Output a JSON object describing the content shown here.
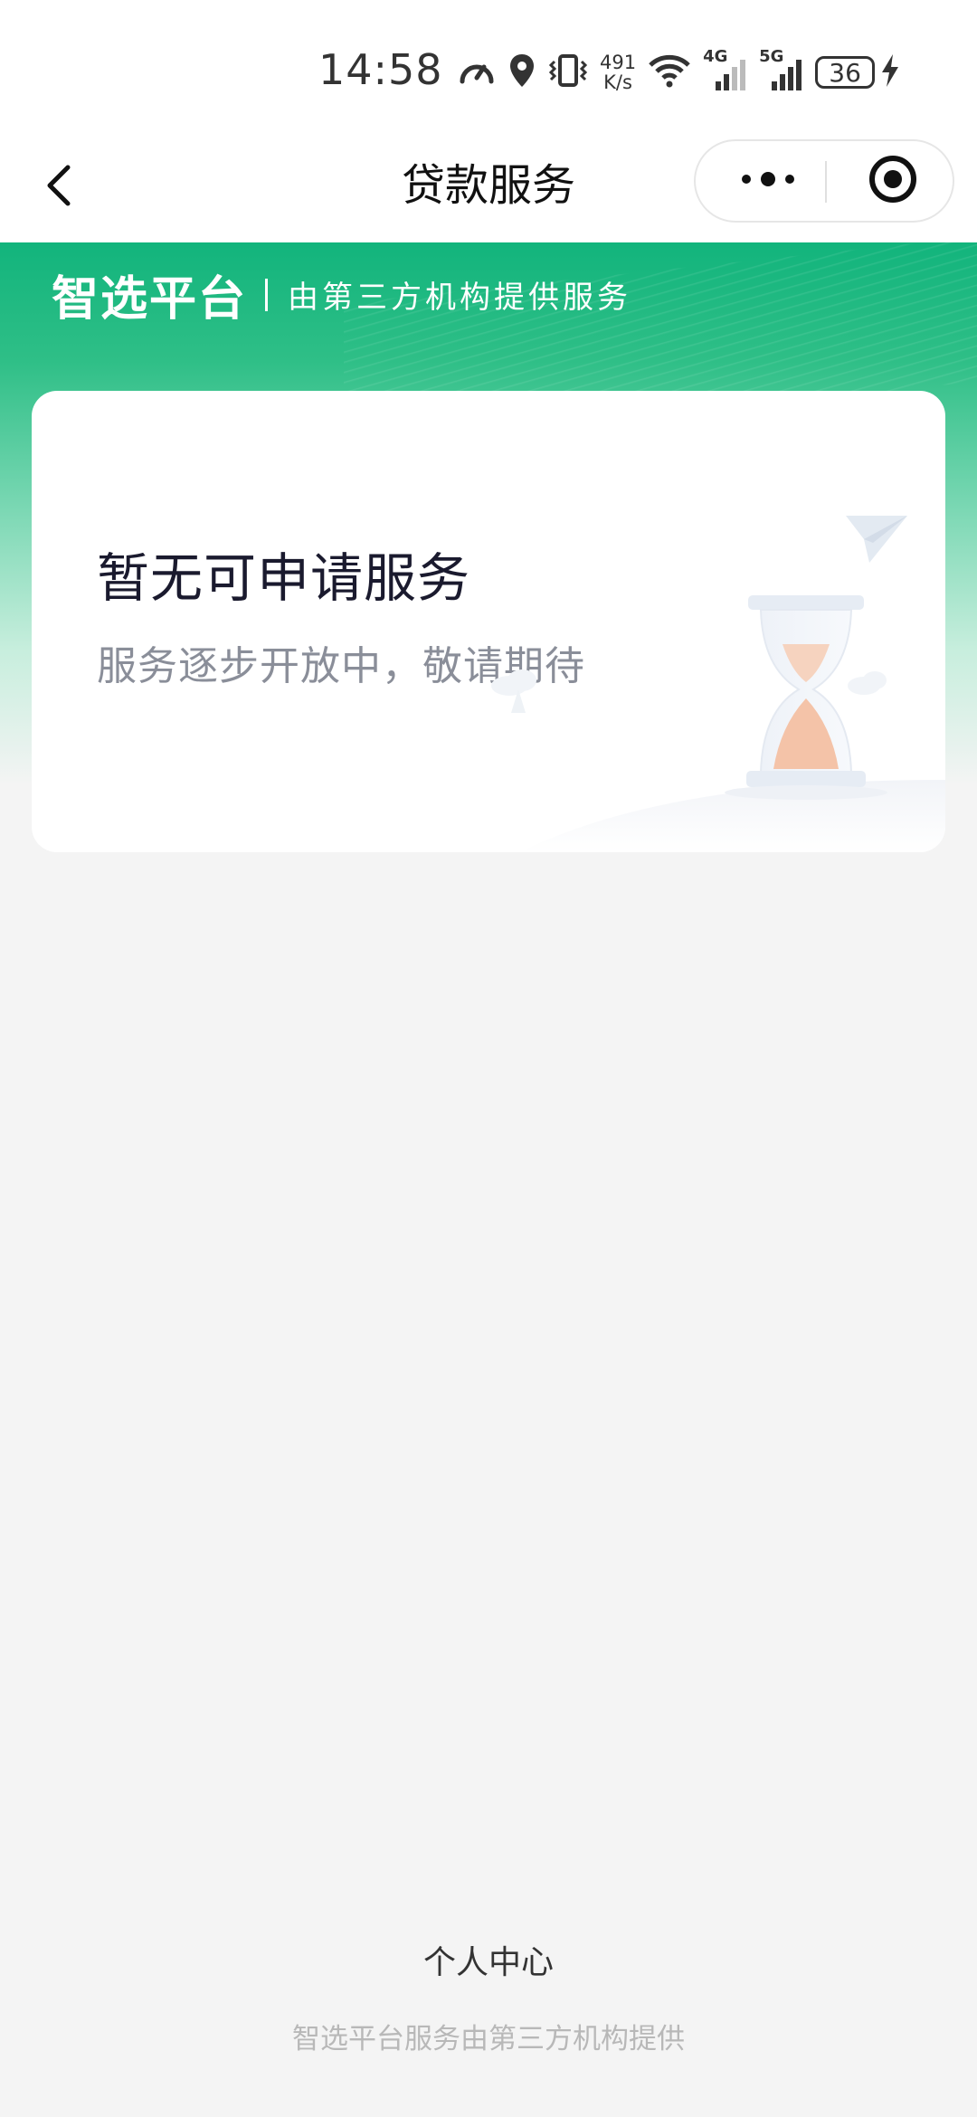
{
  "status_bar": {
    "time": "14:58",
    "net_speed_value": "491",
    "net_speed_unit": "K/s",
    "sim1_gen": "4G",
    "sim2_gen": "5G",
    "battery": "36",
    "icons": [
      "speedometer-icon",
      "location-icon",
      "vibrate-icon",
      "wifi-icon",
      "signal-icon",
      "signal-icon",
      "battery-icon",
      "charging-icon"
    ]
  },
  "nav": {
    "title": "贷款服务",
    "back_icon": "chevron-left-icon",
    "more_icon": "more-dots-icon",
    "close_icon": "target-close-icon"
  },
  "header": {
    "brand": "智选平台",
    "subtitle": "由第三方机构提供服务",
    "colors": {
      "primary": "#12b47c"
    }
  },
  "card": {
    "title": "暂无可申请服务",
    "subtitle": "服务逐步开放中，敬请期待",
    "illustration": "hourglass-illustration"
  },
  "footer": {
    "link": "个人中心",
    "note": "智选平台服务由第三方机构提供"
  }
}
